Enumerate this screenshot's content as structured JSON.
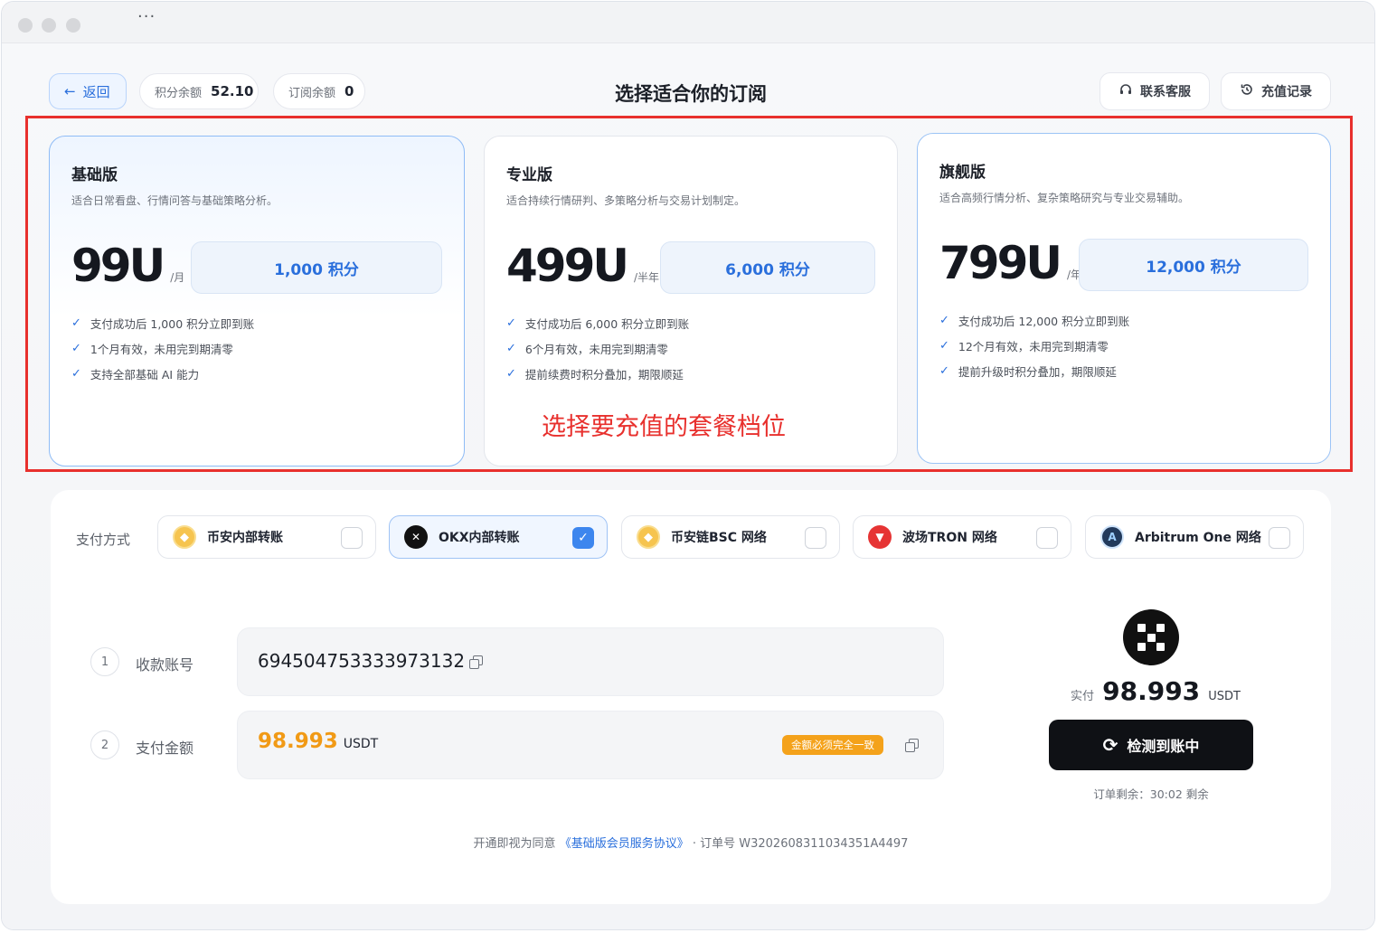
{
  "window": {
    "more_label": "···"
  },
  "header": {
    "back_label": "返回",
    "points_balance_label": "积分余额",
    "points_balance_value": "52.10",
    "subscription_balance_label": "订阅余额",
    "subscription_balance_value": "0",
    "title": "选择适合你的订阅",
    "contact_label": "联系客服",
    "recharge_history_label": "充值记录"
  },
  "plans": [
    {
      "name": "基础版",
      "desc": "适合日常看盘、行情问答与基础策略分析。",
      "price": "99U",
      "period": "/月",
      "points": "1,000 积分",
      "features": [
        "支付成功后 1,000 积分立即到账",
        "1个月有效，未用完到期清零",
        "支持全部基础 AI 能力"
      ],
      "selected": true
    },
    {
      "name": "专业版",
      "desc": "适合持续行情研判、多策略分析与交易计划制定。",
      "price": "499U",
      "period": "/半年",
      "points": "6,000 积分",
      "features": [
        "支付成功后 6,000 积分立即到账",
        "6个月有效，未用完到期清零",
        "提前续费时积分叠加，期限顺延"
      ],
      "selected": false
    },
    {
      "name": "旗舰版",
      "desc": "适合高频行情分析、复杂策略研究与专业交易辅助。",
      "price": "799U",
      "period": "/年",
      "points": "12,000 积分",
      "features": [
        "支付成功后 12,000 积分立即到账",
        "12个月有效，未用完到期清零",
        "提前升级时积分叠加，期限顺延"
      ],
      "selected": false
    }
  ],
  "annotation": "选择要充值的套餐档位",
  "payment": {
    "label": "支付方式",
    "methods": [
      {
        "name": "币安内部转账",
        "icon": "binance-icon",
        "checked": false
      },
      {
        "name": "OKX内部转账",
        "icon": "okx-icon",
        "checked": true
      },
      {
        "name": "币安链BSC 网络",
        "icon": "bnb-chain-icon",
        "checked": false
      },
      {
        "name": "波场TRON 网络",
        "icon": "tron-icon",
        "checked": false
      },
      {
        "name": "Arbitrum One 网络",
        "icon": "arbitrum-icon",
        "checked": false
      }
    ],
    "steps": [
      {
        "num": "1",
        "label": "收款账号",
        "value": "694504753333973132"
      },
      {
        "num": "2",
        "label": "支付金额",
        "value": "98.993",
        "unit": "USDT",
        "badge": "金额必须完全一致"
      }
    ],
    "paid_label": "实付",
    "paid_value": "98.993",
    "paid_unit": "USDT",
    "detect_label": "检测到账中",
    "remaining": "订单剩余：30:02 剩余",
    "agreement_prefix": "开通即视为同意",
    "agreement_link": "《基础版会员服务协议》",
    "order_label": "· 订单号 W3202608311034351A4497"
  },
  "colors": {
    "accent": "#2a6fdc",
    "annotation_red": "#e8302d",
    "amount_orange": "#f19a16"
  }
}
